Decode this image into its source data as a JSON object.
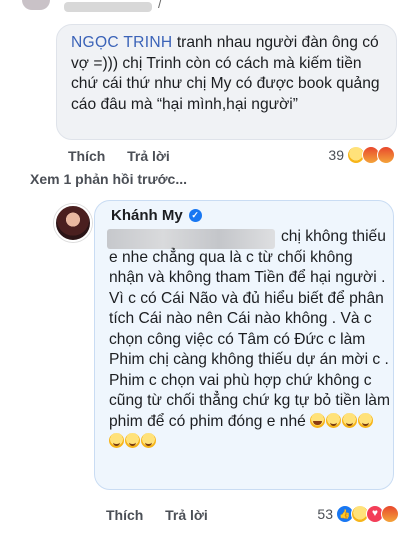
{
  "top": {
    "partial_text": "/"
  },
  "comment1": {
    "mention": "NGỌC TRINH",
    "text": " tranh nhau người đàn ông có vợ =))) chị Trinh còn có cách mà kiếm tiền chứ cái thứ như chị My có được book quảng cáo đâu mà “hại mình,hại người”",
    "like_label": "Thích",
    "reply_label": "Trả lời",
    "reaction_count": "39",
    "reactions": [
      "haha-icon",
      "angry-icon",
      "angry-icon"
    ]
  },
  "more_replies": "Xem 1 phản hồi trước...",
  "comment2": {
    "author": "Khánh My",
    "paragraphs": [
      "chị không thiếu e nhe chẳng qua là c từ chối không nhận và không tham Tiền để hại người . Vì c có Cái Não và đủ hiểu biết để phân tích Cái nào nên Cái nào không . Và c chọn công việc có Tâm có Đức c làm",
      "Phim chị càng không thiếu dự án mời c . Phim c chọn vai phù hợp chứ không c cũng từ chối thẳng chứ kg tự bỏ tiền làm phim để có phim đóng e nhé"
    ],
    "like_label": "Thích",
    "reply_label": "Trả lời",
    "reaction_count": "53",
    "reactions": [
      "like-icon",
      "haha-icon",
      "love-icon",
      "angry-icon"
    ]
  }
}
